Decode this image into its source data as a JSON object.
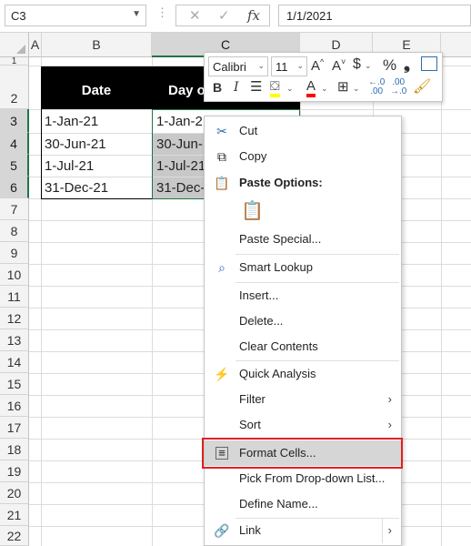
{
  "formula_bar": {
    "name_box": "C3",
    "value": "1/1/2021",
    "cancel_icon": "close-icon",
    "enter_icon": "check-icon",
    "fx_label": "fx"
  },
  "columns": [
    "A",
    "B",
    "C",
    "D",
    "E"
  ],
  "rows": [
    "1",
    "2",
    "3",
    "4",
    "5",
    "6",
    "7",
    "8",
    "9",
    "10",
    "11",
    "12",
    "13",
    "14",
    "15",
    "16",
    "17",
    "18",
    "19",
    "20",
    "21",
    "22"
  ],
  "table": {
    "headers": [
      "Date",
      "Day of"
    ],
    "dates": [
      "1-Jan-21",
      "30-Jun-21",
      "1-Jul-21",
      "31-Dec-21"
    ],
    "days": [
      "1-Jan-2",
      "30-Jun-",
      "1-Jul-21",
      "31-Dec-"
    ]
  },
  "mini_toolbar": {
    "font": "Calibri",
    "size": "11",
    "grow": "A^",
    "shrink": "A˅",
    "currency": "$",
    "percent": "%",
    "comma": "❟",
    "bold": "B",
    "italic": "I",
    "font_color": "A"
  },
  "context_menu": {
    "cut": "Cut",
    "copy": "Copy",
    "paste_options": "Paste Options:",
    "paste_special": "Paste Special...",
    "smart_lookup": "Smart Lookup",
    "insert": "Insert...",
    "delete": "Delete...",
    "clear_contents": "Clear Contents",
    "quick_analysis": "Quick Analysis",
    "filter": "Filter",
    "sort": "Sort",
    "format_cells": "Format Cells...",
    "pick_from_list": "Pick From Drop-down List...",
    "define_name": "Define Name...",
    "link": "Link"
  },
  "colors": {
    "excel_green": "#217346",
    "highlight_box": "#e02020",
    "selection_gray": "#c8c8c8"
  }
}
